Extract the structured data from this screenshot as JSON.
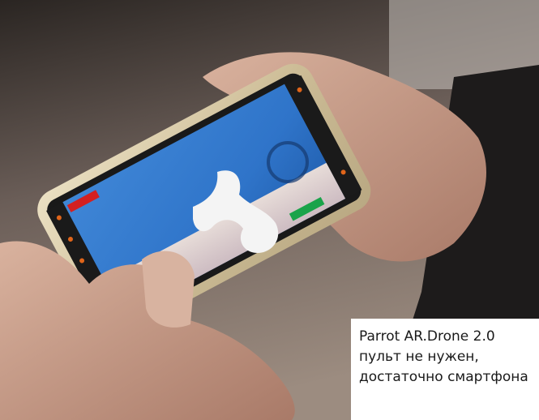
{
  "photo": {
    "description_icon": "hands-holding-smartphone-photo",
    "colors": {
      "background_top": "#2a2522",
      "background_bottom": "#8a7a70",
      "phone_frame": "#d8c9a4",
      "screen_sky": "#2f74c9",
      "app_logo": "#f4f4f4",
      "accent_red": "#d32020",
      "accent_green": "#1aa34a",
      "skin": "#c79c86"
    }
  },
  "caption": {
    "line1": "Parrot AR.Drone 2.0",
    "line2": "пульт не нужен,",
    "line3": "достаточно смартфона"
  }
}
